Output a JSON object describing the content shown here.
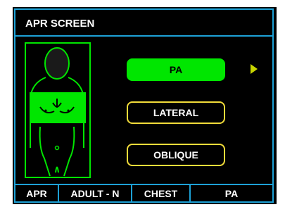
{
  "screen": {
    "title": "APR SCREEN"
  },
  "projections": [
    {
      "label": "PA",
      "selected": true
    },
    {
      "label": "LATERAL",
      "selected": false
    },
    {
      "label": "OBLIQUE",
      "selected": false
    }
  ],
  "status_bar": {
    "mode": "APR",
    "patient": "ADULT - N",
    "region": "CHEST",
    "projection": "PA"
  },
  "icons": {
    "body": "body-diagram-icon",
    "next": "next-arrow-icon"
  },
  "colors": {
    "frame": "#1da1d6",
    "selected": "#00e600",
    "unselected_border": "#f2dc3a",
    "background": "#000000",
    "arrow": "#c8d400"
  }
}
